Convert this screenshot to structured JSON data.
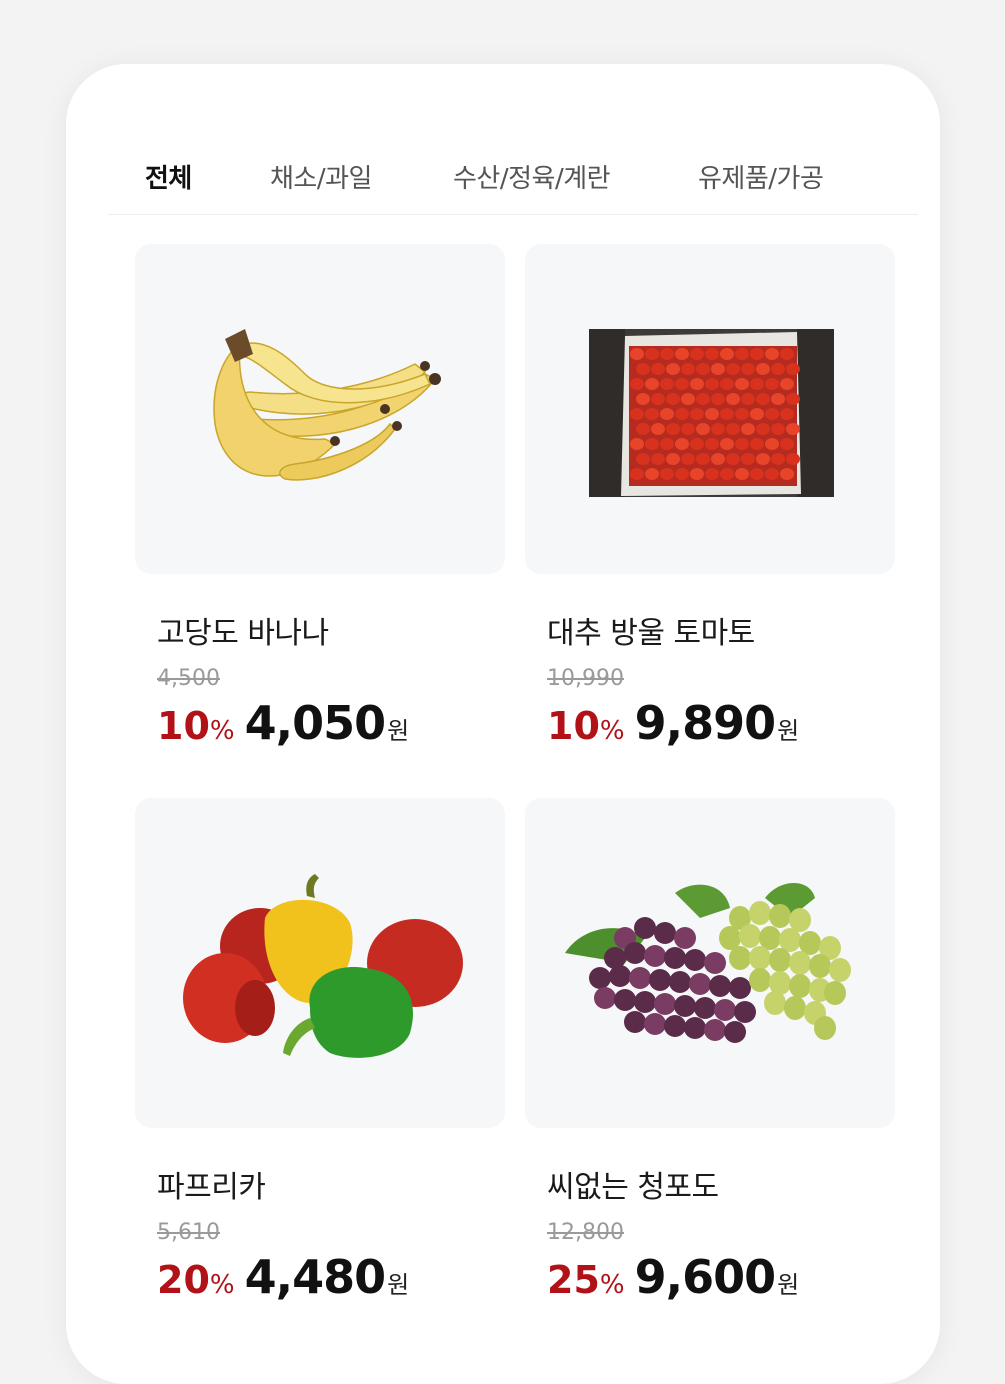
{
  "tabs": [
    "전체",
    "채소/과일",
    "수산/정육/계란",
    "유제품/가공"
  ],
  "active_tab": 0,
  "products": [
    {
      "name": "고당도 바나나",
      "original_price": "4,500",
      "discount": "10",
      "price": "4,050",
      "currency": "원",
      "image": "banana-bunch"
    },
    {
      "name": "대추 방울 토마토",
      "original_price": "10,990",
      "discount": "10",
      "price": "9,890",
      "currency": "원",
      "image": "cherry-tomato-box"
    },
    {
      "name": "파프리카",
      "original_price": "5,610",
      "discount": "20",
      "price": "4,480",
      "currency": "원",
      "image": "bell-peppers"
    },
    {
      "name": "씨없는 청포도",
      "original_price": "12,800",
      "discount": "25",
      "price": "9,600",
      "currency": "원",
      "image": "grapes"
    }
  ],
  "percent_sign": "%",
  "colors": {
    "accent": "#b01218",
    "card_bg": "#f6f7f9"
  }
}
